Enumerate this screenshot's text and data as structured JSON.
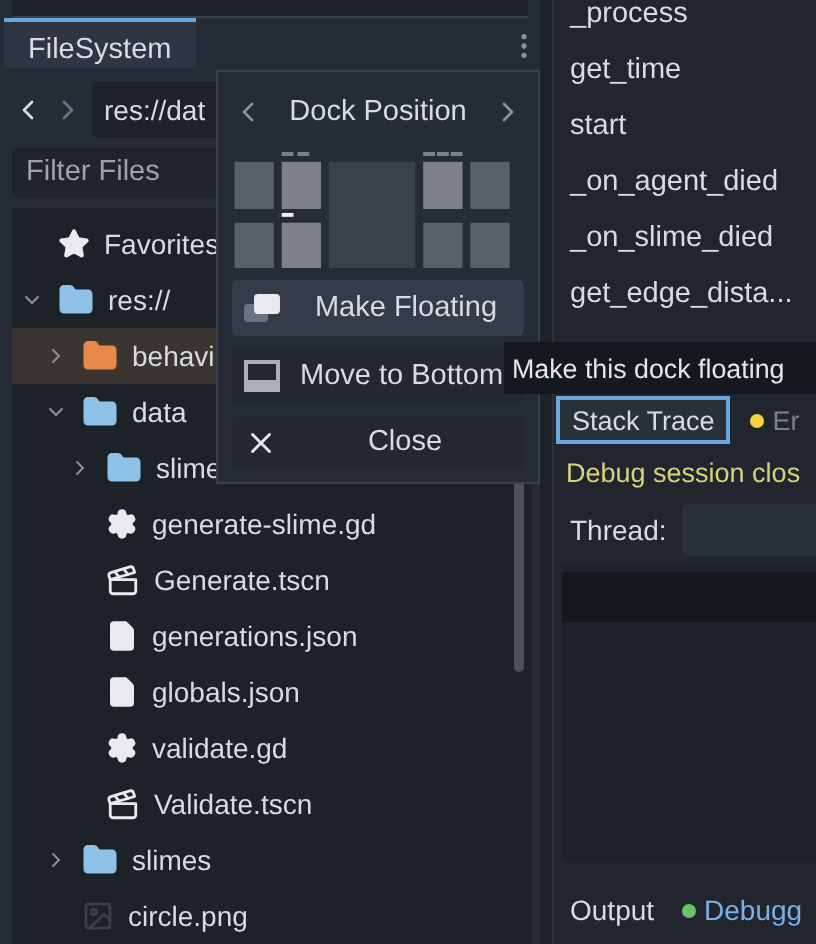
{
  "dock": {
    "tabs": [
      {
        "label": "FileSystem",
        "selected": true
      }
    ],
    "path": "res://dat",
    "filter": {
      "placeholder": "Filter Files"
    }
  },
  "tree": {
    "items": [
      {
        "kind": "favorites",
        "label": "Favorites",
        "selected": false
      },
      {
        "kind": "folder",
        "label": "res://",
        "color": "#8fc2e8",
        "expanded": true,
        "selected": false,
        "children": [
          {
            "kind": "folder",
            "label": "behavi",
            "color": "#e8894a",
            "expanded": false,
            "selected": true
          },
          {
            "kind": "folder",
            "label": "data",
            "color": "#8fc2e8",
            "expanded": true,
            "selected": false,
            "children": [
              {
                "kind": "folder",
                "label": "slime",
                "color": "#8fc2e8",
                "expanded": false,
                "selected": false
              },
              {
                "kind": "script",
                "label": "generate-slime.gd",
                "selected": false
              },
              {
                "kind": "scene",
                "label": "Generate.tscn",
                "selected": false
              },
              {
                "kind": "file",
                "label": "generations.json",
                "selected": false
              },
              {
                "kind": "file",
                "label": "globals.json",
                "selected": false
              },
              {
                "kind": "script",
                "label": "validate.gd",
                "selected": false
              },
              {
                "kind": "scene",
                "label": "Validate.tscn",
                "selected": false
              }
            ]
          },
          {
            "kind": "folder",
            "label": "slimes",
            "color": "#8fc2e8",
            "expanded": false,
            "selected": false
          },
          {
            "kind": "image",
            "label": "circle.png",
            "selected": false
          }
        ]
      }
    ]
  },
  "popup": {
    "title": "Dock Position",
    "buttons": [
      {
        "kind": "float",
        "label": "Make Floating",
        "selected": true
      },
      {
        "kind": "bottom",
        "label": "Move to Bottom",
        "selected": false
      },
      {
        "kind": "close",
        "label": "Close",
        "selected": false
      }
    ]
  },
  "tooltip": "Make this dock floating",
  "methods": [
    "_process",
    "get_time",
    "start",
    "_on_agent_died",
    "_on_slime_died",
    "get_edge_dista..."
  ],
  "debugger": {
    "tabs": [
      {
        "label": "Stack Trace",
        "selected": true
      },
      {
        "label": "Er",
        "selected": false,
        "color": "#f5d442"
      }
    ],
    "message": "Debug session clos",
    "thread_label": "Thread:"
  },
  "bottom_bar": [
    {
      "label": "Output"
    },
    {
      "label": "Debugg",
      "color": "#6cc26c"
    }
  ]
}
